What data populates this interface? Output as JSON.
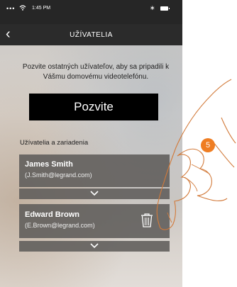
{
  "status_bar": {
    "signal": "••• ",
    "wifi_icon": "wifi-icon",
    "time": "1:45 PM",
    "bluetooth": "∗",
    "battery_icon": "battery-icon"
  },
  "nav": {
    "back": "‹",
    "title": "UŽÍVATELIA"
  },
  "intro_text": "Pozvite ostatných užívateľov, aby sa pripadili k Vášmu domovému videotelefónu.",
  "invite_button": "Pozvite",
  "section_label": "Užívatelia a zariadenia",
  "users": [
    {
      "name": "James Smith",
      "email": "(J.Smith@legrand.com)"
    },
    {
      "name": "Edward Brown",
      "email": "(E.Brown@legrand.com)"
    }
  ],
  "step_number": "5",
  "colors": {
    "accent": "#ef7d22",
    "bar": "#262626",
    "card": "#5f5c5a"
  }
}
